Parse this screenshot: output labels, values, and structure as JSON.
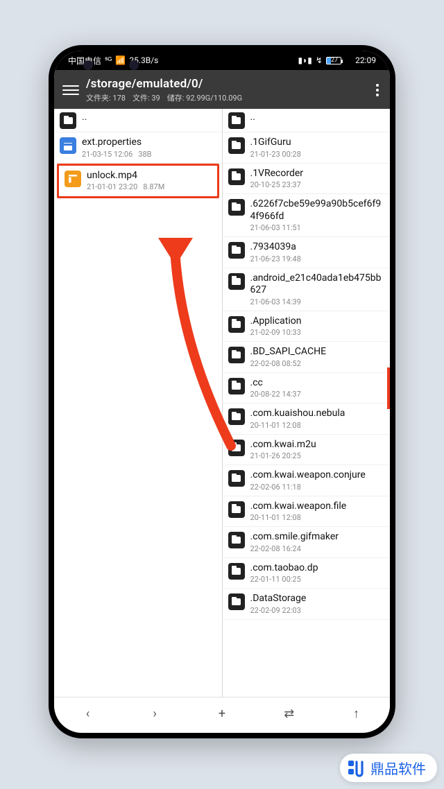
{
  "status": {
    "carrier": "中国电信",
    "speed": "25.3B/s",
    "battery_pct": "27",
    "time": "22:09"
  },
  "header": {
    "path": "/storage/emulated/0/",
    "folders_label": "文件夹:",
    "folders_count": "178",
    "files_label": "文件:",
    "files_count": "39",
    "storage_label": "储存:",
    "storage_value": "92.99G/110.09G"
  },
  "left_pane": {
    "up": "..",
    "items": [
      {
        "type": "doc",
        "name": "ext.properties",
        "date": "21-03-15 12:06",
        "size": "38B"
      },
      {
        "type": "video",
        "name": "unlock.mp4",
        "date": "21-01-01 23:20",
        "size": "8.87M",
        "highlighted": true
      }
    ]
  },
  "right_pane": {
    "up": "..",
    "items": [
      {
        "type": "folder",
        "name": ".1GifGuru",
        "date": "21-01-23 00:28"
      },
      {
        "type": "folder",
        "name": ".1VRecorder",
        "date": "20-10-25 23:37"
      },
      {
        "type": "folder",
        "name": ".6226f7cbe59e99a90b5cef6f94f966fd",
        "date": "21-06-03 11:51"
      },
      {
        "type": "folder",
        "name": ".7934039a",
        "date": "21-06-23 19:48"
      },
      {
        "type": "folder",
        "name": ".android_e21c40ada1eb475bb627",
        "date": "21-06-03 14:39"
      },
      {
        "type": "folder",
        "name": ".Application",
        "date": "21-02-09 10:33"
      },
      {
        "type": "folder",
        "name": ".BD_SAPI_CACHE",
        "date": "22-02-08 08:52"
      },
      {
        "type": "folder",
        "name": ".cc",
        "date": "20-08-22 14:37"
      },
      {
        "type": "folder",
        "name": ".com.kuaishou.nebula",
        "date": "20-11-01 12:08"
      },
      {
        "type": "folder",
        "name": ".com.kwai.m2u",
        "date": "21-01-26 20:25"
      },
      {
        "type": "folder",
        "name": ".com.kwai.weapon.conjure",
        "date": "22-02-06 11:18"
      },
      {
        "type": "folder",
        "name": ".com.kwai.weapon.file",
        "date": "20-11-01 12:08"
      },
      {
        "type": "folder",
        "name": ".com.smile.gifmaker",
        "date": "22-02-08 16:24"
      },
      {
        "type": "folder",
        "name": ".com.taobao.dp",
        "date": "22-01-11 00:25"
      },
      {
        "type": "folder",
        "name": ".DataStorage",
        "date": "22-02-09 22:03"
      }
    ]
  },
  "nav": {
    "back": "‹",
    "fwd": "›",
    "add": "+",
    "swap": "⇄",
    "up": "↑"
  },
  "watermark": {
    "text": "鼎品软件"
  }
}
